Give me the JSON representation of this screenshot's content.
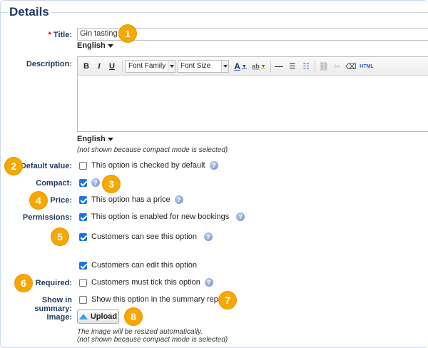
{
  "section_title": "Details",
  "title_field": {
    "label": "Title:",
    "required_mark": "*",
    "value": "Gin tasting",
    "language": "English"
  },
  "description": {
    "label": "Description:",
    "toolbar": {
      "bold": "B",
      "italic": "I",
      "underline": "U",
      "font_family": "Font Family",
      "font_size": "Font Size",
      "text_color": "A",
      "highlight": "ab",
      "html": "HTML"
    },
    "language": "English",
    "note": "(not shown because compact mode is selected)"
  },
  "default_value": {
    "label": "Default value:",
    "checked": false,
    "text": "This option is checked by default"
  },
  "compact": {
    "label": "Compact:",
    "checked": true
  },
  "price": {
    "label": "Price:",
    "checked": true,
    "text": "This option has a price"
  },
  "permissions": {
    "label": "Permissions:",
    "items": [
      {
        "checked": true,
        "text": "This option is enabled for new bookings"
      },
      {
        "checked": true,
        "text": "Customers can see this option"
      },
      {
        "checked": true,
        "text": "Customers can edit this option"
      }
    ]
  },
  "required": {
    "label": "Required:",
    "checked": false,
    "text": "Customers must tick this option"
  },
  "summary": {
    "label": "Show in summary:",
    "checked": false,
    "text": "Show this option in the summary report"
  },
  "image": {
    "label": "Image:",
    "button": "Upload",
    "note1": "The image will be resized automatically.",
    "note2": "(not shown because compact mode is selected)"
  },
  "badges": [
    "1",
    "2",
    "3",
    "4",
    "5",
    "6",
    "7",
    "8"
  ],
  "colors": {
    "label": "#1f3b63",
    "badge": "#f6a700",
    "checkbox": "#1a73e8",
    "required": "#cc0000"
  }
}
